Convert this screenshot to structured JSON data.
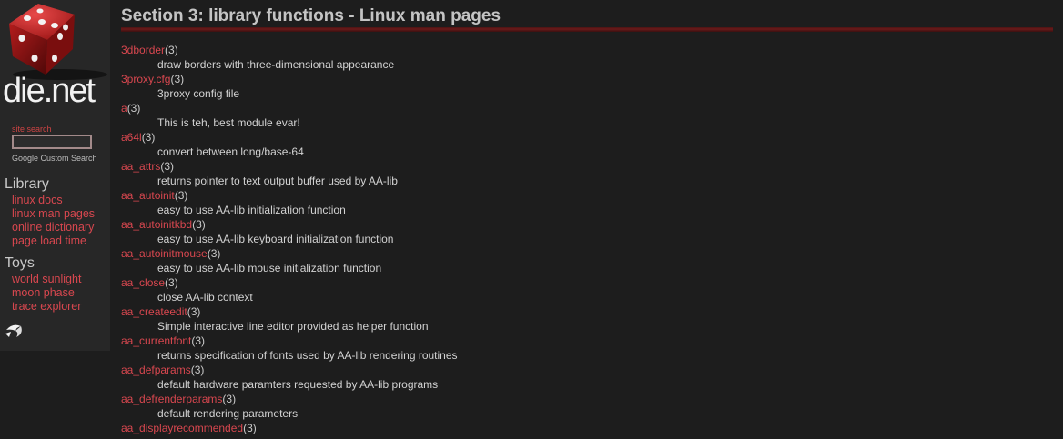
{
  "logo": {
    "text": "die.net"
  },
  "search": {
    "label": "site search",
    "value": "",
    "provider": "Google Custom Search"
  },
  "sidebar": {
    "sections": [
      {
        "heading": "Library",
        "links": [
          "linux docs",
          "linux man pages",
          "online dictionary",
          "page load time"
        ]
      },
      {
        "heading": "Toys",
        "links": [
          "world sunlight",
          "moon phase",
          "trace explorer"
        ]
      }
    ]
  },
  "main": {
    "title": "Section 3: library functions - Linux man pages",
    "entries": [
      {
        "name": "3dborder",
        "section": "(3)",
        "description": "draw borders with three-dimensional appearance"
      },
      {
        "name": "3proxy.cfg",
        "section": "(3)",
        "description": "3proxy config file"
      },
      {
        "name": "a",
        "section": "(3)",
        "description": "This is teh, best module evar!"
      },
      {
        "name": "a64l",
        "section": "(3)",
        "description": "convert between long/base-64"
      },
      {
        "name": "aa_attrs",
        "section": "(3)",
        "description": "returns pointer to text output buffer used by AA-lib"
      },
      {
        "name": "aa_autoinit",
        "section": "(3)",
        "description": "easy to use AA-lib initialization function"
      },
      {
        "name": "aa_autoinitkbd",
        "section": "(3)",
        "description": "easy to use AA-lib keyboard initialization function"
      },
      {
        "name": "aa_autoinitmouse",
        "section": "(3)",
        "description": "easy to use AA-lib mouse initialization function"
      },
      {
        "name": "aa_close",
        "section": "(3)",
        "description": "close AA-lib context"
      },
      {
        "name": "aa_createedit",
        "section": "(3)",
        "description": "Simple interactive line editor provided as helper function"
      },
      {
        "name": "aa_currentfont",
        "section": "(3)",
        "description": "returns specification of fonts used by AA-lib rendering routines"
      },
      {
        "name": "aa_defparams",
        "section": "(3)",
        "description": "default hardware paramters requested by AA-lib programs"
      },
      {
        "name": "aa_defrenderparams",
        "section": "(3)",
        "description": "default rendering parameters"
      },
      {
        "name": "aa_displayrecommended",
        "section": "(3)",
        "description": ""
      }
    ]
  },
  "colors": {
    "background": "#1d1d1d",
    "sidebar": "#272727",
    "link": "#d8474f",
    "text": "#d2d2d2",
    "title": "#c4c4c4",
    "rule": "#6b1a1a"
  },
  "icons": {
    "logo": "red-die-icon",
    "back": "curved-back-arrow-icon"
  }
}
